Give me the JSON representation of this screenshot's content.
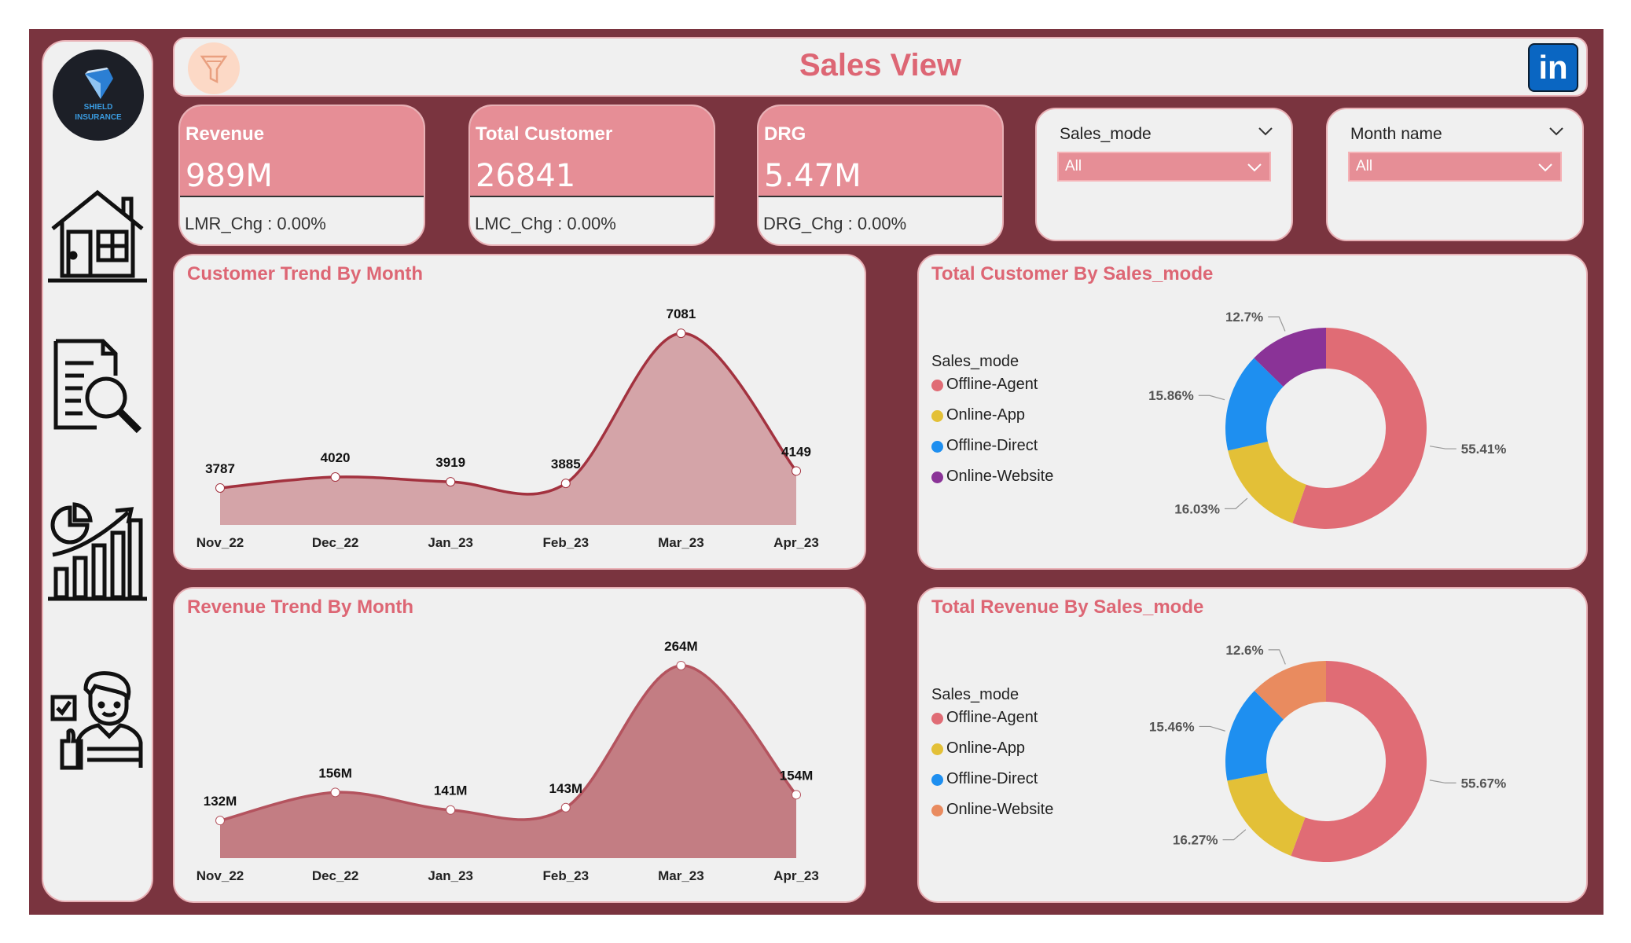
{
  "header": {
    "title": "Sales View",
    "linkedin_label": "in"
  },
  "logo": {
    "line1": "SHIELD",
    "line2": "INSURANCE"
  },
  "sidebar": {
    "items": [
      {
        "icon": "home-icon"
      },
      {
        "icon": "report-search-icon"
      },
      {
        "icon": "growth-chart-icon"
      },
      {
        "icon": "support-agent-icon"
      }
    ]
  },
  "kpis": [
    {
      "label": "Revenue",
      "value": "989M",
      "change": "LMR_Chg : 0.00%"
    },
    {
      "label": "Total Customer",
      "value": "26841",
      "change": "LMC_Chg : 0.00%"
    },
    {
      "label": "DRG",
      "value": "5.47M",
      "change": "DRG_Chg : 0.00%"
    }
  ],
  "slicers": [
    {
      "title": "Sales_mode",
      "selected": "All"
    },
    {
      "title": "Month name",
      "selected": "All"
    }
  ],
  "colors": {
    "frame": "#7a343f",
    "accent": "#dd6674",
    "kpi": "#e68e96",
    "offline_agent": "#e06c75",
    "online_app": "#e3c037",
    "offline_direct": "#1e8ff0",
    "online_website_customer": "#8a3397",
    "online_website_revenue": "#e98b5f"
  },
  "chart_data": [
    {
      "type": "area",
      "title": "Customer Trend By Month",
      "categories": [
        "Nov_22",
        "Dec_22",
        "Jan_23",
        "Feb_23",
        "Mar_23",
        "Apr_23"
      ],
      "values": [
        3787,
        4020,
        3919,
        3885,
        7081,
        4149
      ],
      "labels": [
        "3787",
        "4020",
        "3919",
        "3885",
        "7081",
        "4149"
      ],
      "fill": "#d4a4a8",
      "stroke": "#a3323f"
    },
    {
      "type": "pie",
      "title": "Total Customer By Sales_mode",
      "legend_title": "Sales_mode",
      "slices": [
        {
          "name": "Offline-Agent",
          "value": 55.41,
          "label": "55.41%"
        },
        {
          "name": "Online-App",
          "value": 16.03,
          "label": "16.03%"
        },
        {
          "name": "Offline-Direct",
          "value": 15.86,
          "label": "15.86%"
        },
        {
          "name": "Online-Website",
          "value": 12.7,
          "label": "12.7%"
        }
      ]
    },
    {
      "type": "area",
      "title": "Revenue Trend By Month",
      "categories": [
        "Nov_22",
        "Dec_22",
        "Jan_23",
        "Feb_23",
        "Mar_23",
        "Apr_23"
      ],
      "values": [
        132,
        156,
        141,
        143,
        264,
        154
      ],
      "labels": [
        "132M",
        "156M",
        "141M",
        "143M",
        "264M",
        "154M"
      ],
      "fill": "#c37d83",
      "stroke": "#b4535e"
    },
    {
      "type": "pie",
      "title": "Total Revenue By Sales_mode",
      "legend_title": "Sales_mode",
      "slices": [
        {
          "name": "Offline-Agent",
          "value": 55.67,
          "label": "55.67%"
        },
        {
          "name": "Online-App",
          "value": 16.27,
          "label": "16.27%"
        },
        {
          "name": "Offline-Direct",
          "value": 15.46,
          "label": "15.46%"
        },
        {
          "name": "Online-Website",
          "value": 12.6,
          "label": "12.6%"
        }
      ]
    }
  ]
}
